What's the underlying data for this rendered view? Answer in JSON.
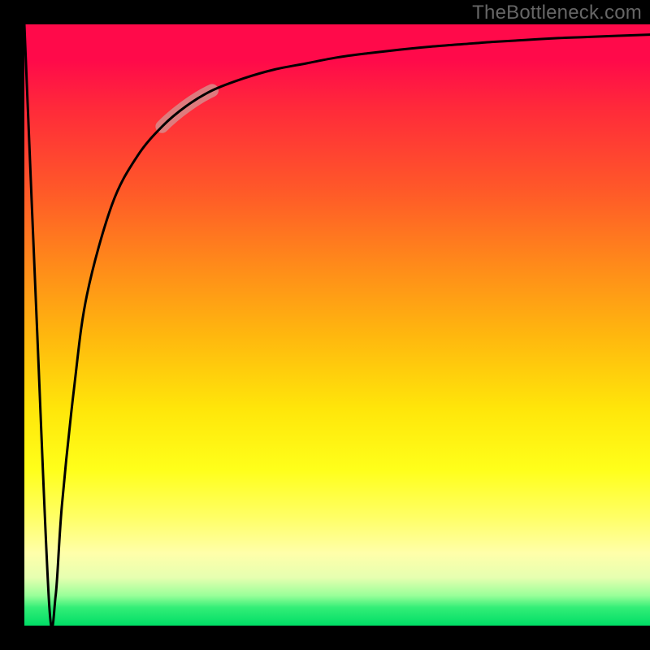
{
  "watermark": "TheBottleneck.com",
  "chart_data": {
    "type": "line",
    "title": "",
    "xlabel": "",
    "ylabel": "",
    "x": [
      0.0,
      0.02,
      0.04,
      0.05,
      0.06,
      0.08,
      0.1,
      0.14,
      0.18,
      0.22,
      0.26,
      0.3,
      0.35,
      0.4,
      0.45,
      0.5,
      0.55,
      0.6,
      0.65,
      0.7,
      0.75,
      0.8,
      0.85,
      0.9,
      0.95,
      1.0
    ],
    "values": [
      1.0,
      0.5,
      0.03,
      0.05,
      0.2,
      0.4,
      0.55,
      0.7,
      0.78,
      0.83,
      0.865,
      0.89,
      0.91,
      0.925,
      0.935,
      0.945,
      0.952,
      0.958,
      0.963,
      0.967,
      0.971,
      0.974,
      0.977,
      0.979,
      0.981,
      0.983
    ],
    "xlim": [
      0,
      1
    ],
    "ylim": [
      0,
      1
    ],
    "gradient_stops": [
      {
        "pos": 0.0,
        "color": "#ff0a4a"
      },
      {
        "pos": 0.06,
        "color": "#ff0a4a"
      },
      {
        "pos": 0.14,
        "color": "#ff2a3a"
      },
      {
        "pos": 0.28,
        "color": "#ff5a28"
      },
      {
        "pos": 0.4,
        "color": "#ff8a1a"
      },
      {
        "pos": 0.52,
        "color": "#ffb80e"
      },
      {
        "pos": 0.64,
        "color": "#ffe60a"
      },
      {
        "pos": 0.74,
        "color": "#ffff1a"
      },
      {
        "pos": 0.82,
        "color": "#ffff66"
      },
      {
        "pos": 0.88,
        "color": "#ffffaa"
      },
      {
        "pos": 0.92,
        "color": "#e6ffb0"
      },
      {
        "pos": 0.95,
        "color": "#99ff99"
      },
      {
        "pos": 0.97,
        "color": "#33ee77"
      },
      {
        "pos": 1.0,
        "color": "#00dd66"
      }
    ],
    "highlight_segment": {
      "x_start": 0.22,
      "x_end": 0.3,
      "color": "#d88a8a",
      "width": 16
    },
    "curve_style": {
      "color": "#000000",
      "width": 3
    }
  }
}
